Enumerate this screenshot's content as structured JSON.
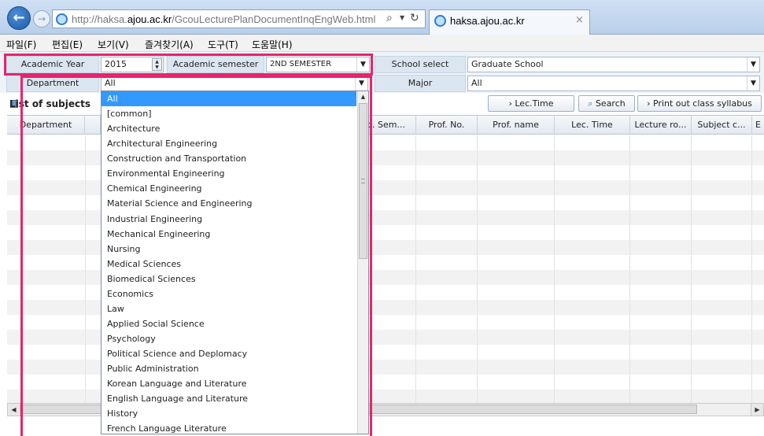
{
  "browser": {
    "url_prefix": "http://haksa.",
    "url_domain": "ajou.ac.kr",
    "url_path": "/GcouLecturePlanDocumentInqEngWeb.html",
    "tab_title": "haksa.ajou.ac.kr",
    "tab_close": "×"
  },
  "menu": [
    "파일(F)",
    "편집(E)",
    "보기(V)",
    "즐겨찾기(A)",
    "도구(T)",
    "도움말(H)"
  ],
  "form": {
    "academic_year_label": "Academic Year",
    "academic_year_value": "2015",
    "semester_label": "Academic semester",
    "semester_value": "2ND SEMESTER",
    "school_label": "School select",
    "school_value": "Graduate School",
    "department_label": "Department",
    "department_value": "All",
    "major_label": "Major",
    "major_value": "All"
  },
  "toolbar": {
    "list_title": "List of subjects",
    "lec_time_button": "› Lec.Time",
    "search_button": "Search",
    "print_button": "› Print out class syllabus"
  },
  "grid": {
    "columns": [
      "Department",
      "",
      "",
      "",
      "",
      "c. Sem...",
      "Prof. No.",
      "Prof. name",
      "Lec. Time",
      "Lecture ro...",
      "Subject c...",
      "E"
    ]
  },
  "department_options": [
    "All",
    "[common]",
    "Architecture",
    "Architectural Engineering",
    "Construction and Transportation",
    "Environmental Engineering",
    "Chemical Engineering",
    "Material Science and Engineering",
    "Industrial Engineering",
    "Mechanical Engineering",
    "Nursing",
    "Medical Sciences",
    "Biomedical Sciences",
    "Economics",
    "Law",
    "Applied Social Science",
    "Psychology",
    "Political Science and Deplomacy",
    "Public Administration",
    "Korean Language and Literature",
    "English Language and Literature",
    "History",
    "French Language Literature"
  ],
  "selected_department_index": 0,
  "colors": {
    "highlight": "#e8246b",
    "selection": "#3399ff",
    "label_bg": "#dce6f1"
  }
}
